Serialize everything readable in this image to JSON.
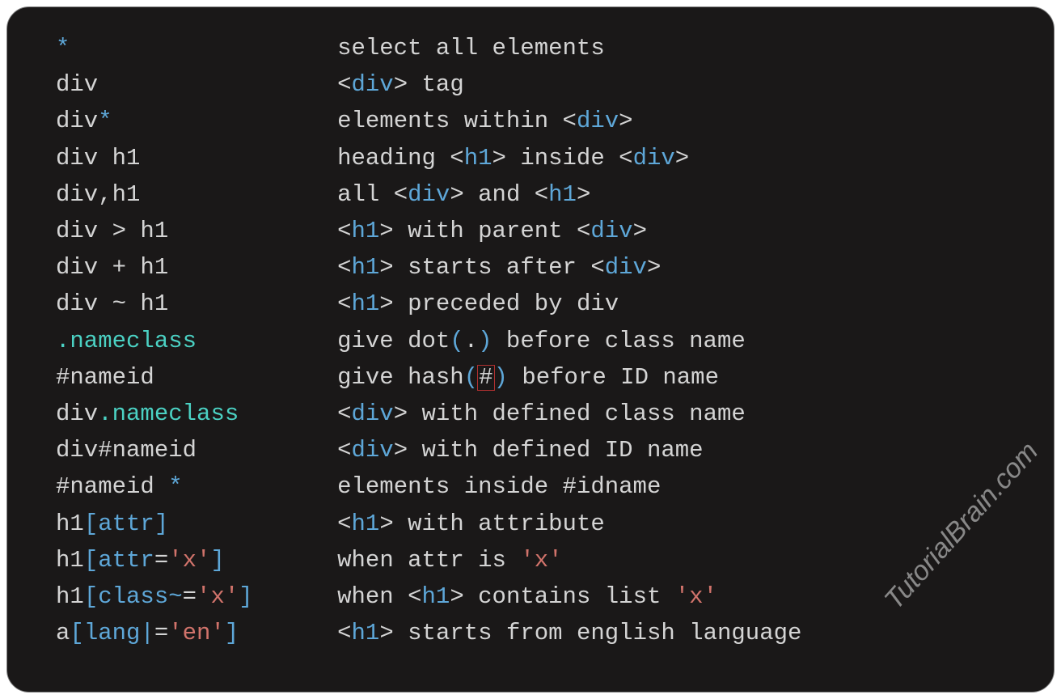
{
  "watermark": "TutorialBrain.com",
  "rows": [
    {
      "sel": [
        {
          "t": "*",
          "c": "keyword"
        }
      ],
      "desc": [
        {
          "t": "select all elements"
        }
      ]
    },
    {
      "sel": [
        {
          "t": "div"
        }
      ],
      "desc": [
        {
          "t": "<"
        },
        {
          "t": "div",
          "c": "keyword"
        },
        {
          "t": ">"
        },
        {
          "t": " tag"
        }
      ]
    },
    {
      "sel": [
        {
          "t": "div"
        },
        {
          "t": "*",
          "c": "keyword"
        }
      ],
      "desc": [
        {
          "t": "elements within "
        },
        {
          "t": "<"
        },
        {
          "t": "div",
          "c": "keyword"
        },
        {
          "t": ">"
        }
      ]
    },
    {
      "sel": [
        {
          "t": "div h1"
        }
      ],
      "desc": [
        {
          "t": "heading "
        },
        {
          "t": "<"
        },
        {
          "t": "h1",
          "c": "keyword"
        },
        {
          "t": ">"
        },
        {
          "t": " inside "
        },
        {
          "t": "<"
        },
        {
          "t": "div",
          "c": "keyword"
        },
        {
          "t": ">"
        }
      ]
    },
    {
      "sel": [
        {
          "t": "div"
        },
        {
          "t": ",",
          "c": "punct"
        },
        {
          "t": "h1"
        }
      ],
      "desc": [
        {
          "t": "all "
        },
        {
          "t": "<"
        },
        {
          "t": "div",
          "c": "keyword"
        },
        {
          "t": ">"
        },
        {
          "t": " and "
        },
        {
          "t": "<"
        },
        {
          "t": "h1",
          "c": "keyword"
        },
        {
          "t": ">"
        }
      ]
    },
    {
      "sel": [
        {
          "t": "div > h1"
        }
      ],
      "desc": [
        {
          "t": "<"
        },
        {
          "t": "h1",
          "c": "keyword"
        },
        {
          "t": ">"
        },
        {
          "t": " with parent "
        },
        {
          "t": "<"
        },
        {
          "t": "div",
          "c": "keyword"
        },
        {
          "t": ">"
        }
      ]
    },
    {
      "sel": [
        {
          "t": "div + h1"
        }
      ],
      "desc": [
        {
          "t": "<"
        },
        {
          "t": "h1",
          "c": "keyword"
        },
        {
          "t": ">"
        },
        {
          "t": " starts after "
        },
        {
          "t": "<"
        },
        {
          "t": "div",
          "c": "keyword"
        },
        {
          "t": ">"
        }
      ]
    },
    {
      "sel": [
        {
          "t": "div ~ h1"
        }
      ],
      "desc": [
        {
          "t": "<"
        },
        {
          "t": "h1",
          "c": "keyword"
        },
        {
          "t": ">"
        },
        {
          "t": " preceded by div"
        }
      ]
    },
    {
      "sel": [
        {
          "t": ".nameclass",
          "c": "selector"
        }
      ],
      "desc": [
        {
          "t": "give dot"
        },
        {
          "t": "(",
          "c": "bracket"
        },
        {
          "t": "."
        },
        {
          "t": ")",
          "c": "bracket"
        },
        {
          "t": " before class name"
        }
      ]
    },
    {
      "sel": [
        {
          "t": "#nameid"
        }
      ],
      "desc": [
        {
          "t": "give hash"
        },
        {
          "t": "(",
          "c": "bracket"
        },
        {
          "t": "#",
          "c": "errbox"
        },
        {
          "t": ")",
          "c": "bracket"
        },
        {
          "t": " before ID name"
        }
      ]
    },
    {
      "sel": [
        {
          "t": "div"
        },
        {
          "t": ".nameclass",
          "c": "selector"
        }
      ],
      "desc": [
        {
          "t": "<"
        },
        {
          "t": "div",
          "c": "keyword"
        },
        {
          "t": ">"
        },
        {
          "t": " with defined class name"
        }
      ]
    },
    {
      "sel": [
        {
          "t": "div#nameid"
        }
      ],
      "desc": [
        {
          "t": "<"
        },
        {
          "t": "div",
          "c": "keyword"
        },
        {
          "t": ">"
        },
        {
          "t": " with defined ID name"
        }
      ]
    },
    {
      "sel": [
        {
          "t": "#nameid "
        },
        {
          "t": "*",
          "c": "keyword"
        }
      ],
      "desc": [
        {
          "t": "elements inside #idname"
        }
      ]
    },
    {
      "sel": [
        {
          "t": "h1"
        },
        {
          "t": "[",
          "c": "bracket"
        },
        {
          "t": "attr",
          "c": "keyword"
        },
        {
          "t": "]",
          "c": "bracket"
        }
      ],
      "desc": [
        {
          "t": "<"
        },
        {
          "t": "h1",
          "c": "keyword"
        },
        {
          "t": ">"
        },
        {
          "t": " with attribute"
        }
      ]
    },
    {
      "sel": [
        {
          "t": "h1"
        },
        {
          "t": "[",
          "c": "bracket"
        },
        {
          "t": "attr",
          "c": "keyword"
        },
        {
          "t": "="
        },
        {
          "t": "'x'",
          "c": "string"
        },
        {
          "t": "]",
          "c": "bracket"
        }
      ],
      "desc": [
        {
          "t": "when attr is "
        },
        {
          "t": "'x'",
          "c": "string"
        }
      ]
    },
    {
      "sel": [
        {
          "t": "h1"
        },
        {
          "t": "[",
          "c": "bracket"
        },
        {
          "t": "class",
          "c": "keyword"
        },
        {
          "t": "~",
          "c": "keyword"
        },
        {
          "t": "="
        },
        {
          "t": "'x'",
          "c": "string"
        },
        {
          "t": "]",
          "c": "bracket"
        }
      ],
      "desc": [
        {
          "t": "when "
        },
        {
          "t": "<"
        },
        {
          "t": "h1",
          "c": "keyword"
        },
        {
          "t": ">"
        },
        {
          "t": " contains list "
        },
        {
          "t": "'x'",
          "c": "string"
        }
      ]
    },
    {
      "sel": [
        {
          "t": "a"
        },
        {
          "t": "[",
          "c": "bracket"
        },
        {
          "t": "lang",
          "c": "keyword"
        },
        {
          "t": "|",
          "c": "keyword"
        },
        {
          "t": "="
        },
        {
          "t": "'en'",
          "c": "string"
        },
        {
          "t": "]",
          "c": "bracket"
        }
      ],
      "desc": [
        {
          "t": "<"
        },
        {
          "t": "h1",
          "c": "keyword"
        },
        {
          "t": ">"
        },
        {
          "t": " starts from english language"
        }
      ]
    }
  ],
  "layout": {
    "desc_col": 20
  }
}
